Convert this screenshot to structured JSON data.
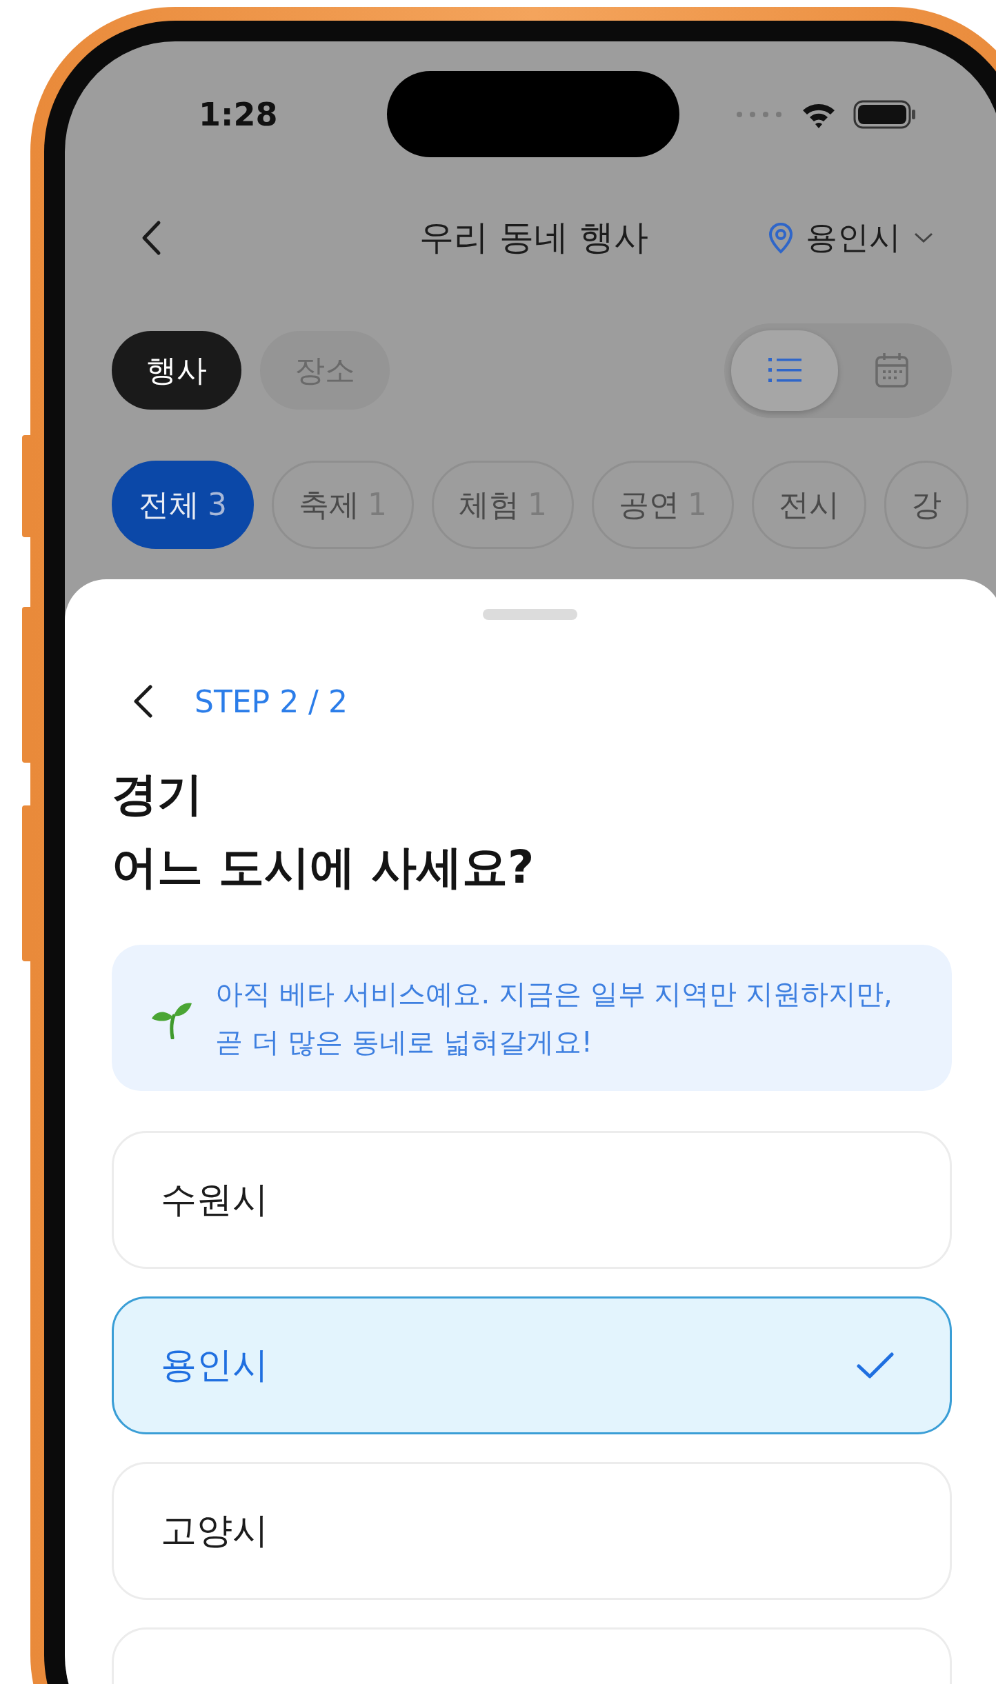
{
  "status_bar": {
    "time": "1:28"
  },
  "header": {
    "title": "우리 동네 행사",
    "location": "용인시"
  },
  "tabs": [
    {
      "label": "행사",
      "selected": true
    },
    {
      "label": "장소",
      "selected": false
    }
  ],
  "view_toggle": [
    {
      "kind": "list",
      "selected": true
    },
    {
      "kind": "calendar",
      "selected": false
    }
  ],
  "filters": [
    {
      "label": "전체",
      "count": "3",
      "selected": true
    },
    {
      "label": "축제",
      "count": "1",
      "selected": false
    },
    {
      "label": "체험",
      "count": "1",
      "selected": false
    },
    {
      "label": "공연",
      "count": "1",
      "selected": false
    },
    {
      "label": "전시",
      "selected": false
    },
    {
      "label": "강",
      "selected": false
    }
  ],
  "sheet": {
    "step": "STEP 2 / 2",
    "region": "경기",
    "question": "어느 도시에 사세요?",
    "notice": "아직 베타 서비스예요. 지금은 일부 지역만 지원하지만,\n곧 더 많은 동네로 넓혀갈게요!",
    "options": [
      {
        "label": "수원시",
        "selected": false
      },
      {
        "label": "용인시",
        "selected": true
      },
      {
        "label": "고양시",
        "selected": false
      }
    ]
  }
}
